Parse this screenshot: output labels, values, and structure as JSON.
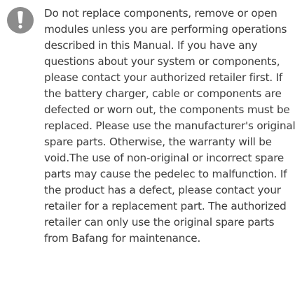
{
  "notice": {
    "icon": "exclamation-icon",
    "lines": [
      "Do not replace components, remove or open",
      "modules unless you are performing operations",
      "described in this Manual. If you have any",
      "questions about your system or components,",
      "please contact your authorized retailer first. If",
      "the battery charger, cable or components are",
      "defected or worn out, the components must be",
      "replaced. Please use the manufacturer's original",
      "spare parts. Otherwise, the warranty will be",
      "void.The use of non-original or incorrect spare",
      "parts may cause the pedelec to malfunction. If",
      "the product has a defect, please contact your",
      "retailer for a replacement part. The authorized",
      "retailer can only use the original spare parts",
      "from Bafang for maintenance."
    ]
  },
  "colors": {
    "icon_background": "#8c8c8c",
    "icon_glyph": "#ffffff",
    "text": "#3c3c3c"
  }
}
